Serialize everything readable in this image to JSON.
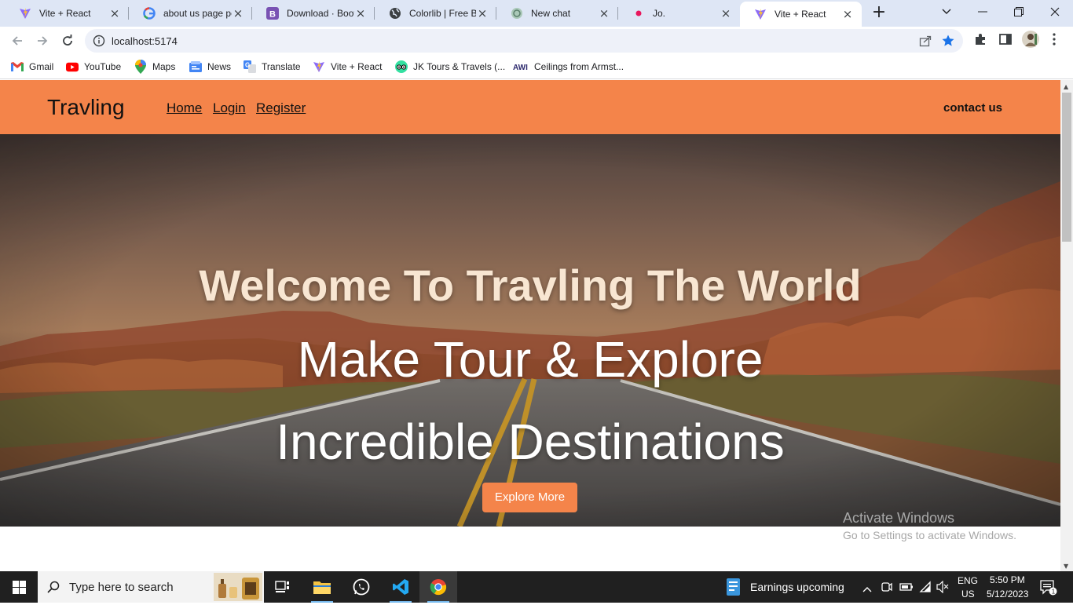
{
  "browser": {
    "tabs": [
      {
        "label": "Vite + React",
        "icon": "vite-icon",
        "active": false
      },
      {
        "label": "about us page pc",
        "icon": "google-icon",
        "active": false
      },
      {
        "label": "Download · Boots",
        "icon": "bootstrap-icon",
        "active": false
      },
      {
        "label": "Colorlib | Free Bo",
        "icon": "globe-icon",
        "active": false
      },
      {
        "label": "New chat",
        "icon": "chatgpt-icon",
        "active": false
      },
      {
        "label": "Jo.",
        "icon": "dot-icon",
        "active": false
      },
      {
        "label": "Vite + React",
        "icon": "vite-icon",
        "active": true
      }
    ],
    "url": "localhost:5174",
    "bookmarks": [
      {
        "label": "Gmail",
        "icon": "gmail-icon"
      },
      {
        "label": "YouTube",
        "icon": "youtube-icon"
      },
      {
        "label": "Maps",
        "icon": "maps-icon"
      },
      {
        "label": "News",
        "icon": "news-icon"
      },
      {
        "label": "Translate",
        "icon": "translate-icon"
      },
      {
        "label": "Vite + React",
        "icon": "vite-icon"
      },
      {
        "label": "JK Tours & Travels (...",
        "icon": "tripadvisor-icon"
      },
      {
        "label": "Ceilings from Armst...",
        "icon": "awi-icon"
      }
    ],
    "awi_text": "AWI"
  },
  "site": {
    "brand": "Travling",
    "nav": [
      {
        "label": "Home"
      },
      {
        "label": "Login"
      },
      {
        "label": "Register"
      }
    ],
    "contact": "contact us",
    "accent_color": "#f4844a",
    "hero": {
      "title": "Welcome To Travling The World",
      "line1": "Make Tour & Explore",
      "line2": "Incredible Destinations",
      "button": "Explore More"
    }
  },
  "watermark": {
    "line1": "Activate Windows",
    "line2": "Go to Settings to activate Windows."
  },
  "taskbar": {
    "search_placeholder": "Type here to search",
    "widget": "Earnings upcoming",
    "lang1": "ENG",
    "lang2": "US",
    "time": "5:50 PM",
    "date": "5/12/2023",
    "notification_count": "1"
  }
}
